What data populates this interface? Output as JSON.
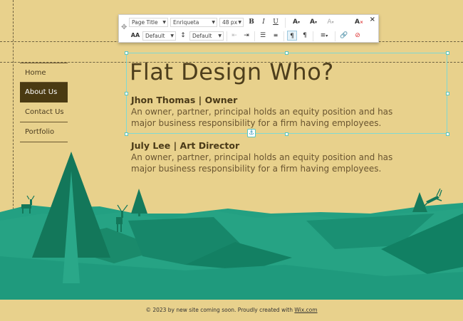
{
  "nav": {
    "items": [
      {
        "label": "Home",
        "active": false
      },
      {
        "label": "About Us",
        "active": true
      },
      {
        "label": "Contact Us",
        "active": false
      },
      {
        "label": "Portfolio",
        "active": false
      }
    ]
  },
  "content": {
    "title": "Flat Design Who?",
    "people": [
      {
        "name": "Jhon Thomas | Owner",
        "desc": "An owner, partner, principal holds an equity position and has major business responsibility for a firm having employees."
      },
      {
        "name": "July Lee | Art Director",
        "desc": "An owner, partner, principal holds an equity position and has major business responsibility for a firm having employees."
      }
    ]
  },
  "toolbar": {
    "style_select": "Page Title",
    "font_select": "Enriqueta",
    "size_select": "48 px",
    "letter_spacing_select": "Default",
    "line_height_select": "Default",
    "bold_label": "B",
    "italic_label": "I",
    "underline_label": "U",
    "close_label": "×",
    "icons": [
      "move-grip-icon",
      "text-color-icon",
      "highlight-color-icon",
      "text-effect-icon",
      "clear-format-icon",
      "letter-spacing-icon",
      "line-height-icon",
      "indent-decrease-icon",
      "indent-increase-icon",
      "bullet-list-icon",
      "numbered-list-icon",
      "ltr-icon",
      "rtl-icon",
      "align-icon",
      "link-icon",
      "unlink-icon"
    ]
  },
  "footer": {
    "text": "© 2023 by new site coming soon. Proudly created with ",
    "link": "Wix.com"
  },
  "colors": {
    "background": "#e8d18c",
    "nav_active": "#4a3a12",
    "hill_light": "#25a386",
    "hill_dark": "#137a5c",
    "selection": "#7fd9d3"
  }
}
